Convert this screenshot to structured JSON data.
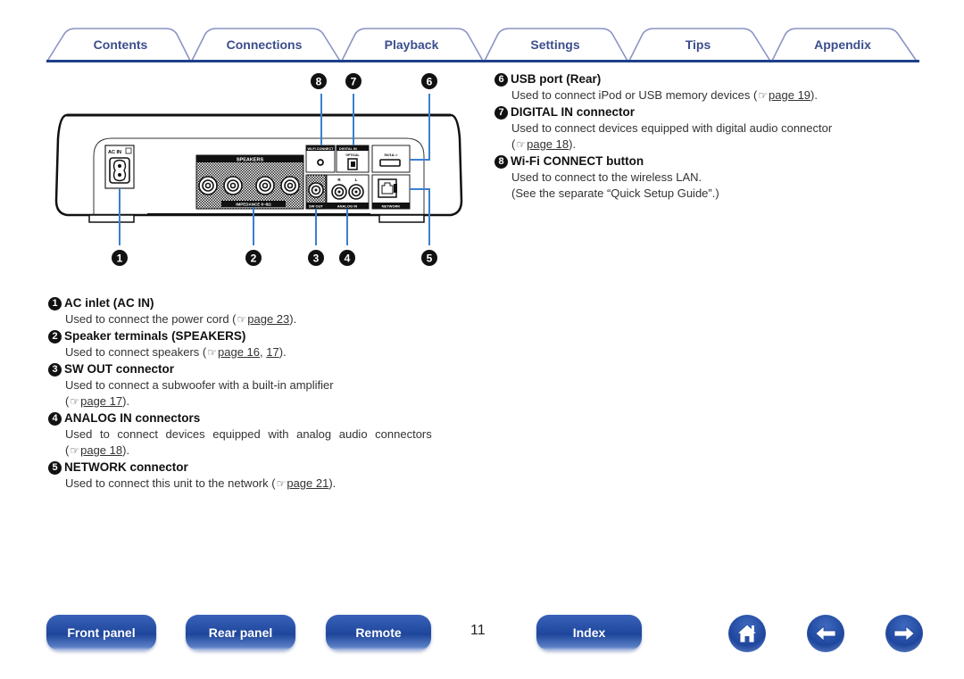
{
  "tabs": [
    {
      "label": "Contents"
    },
    {
      "label": "Connections"
    },
    {
      "label": "Playback"
    },
    {
      "label": "Settings"
    },
    {
      "label": "Tips"
    },
    {
      "label": "Appendix"
    }
  ],
  "device_panel": {
    "labels": {
      "ac_in": "AC IN",
      "speakers": "SPEAKERS",
      "impedance": "IMPEDANCE 6~8Ω",
      "wifi_connect": "Wi-Fi CONNECT",
      "digital_in": "DIGITAL   IN",
      "optical": "OPTICAL",
      "usb": "5V/1A ═",
      "sw_out": "SW OUT",
      "analog_in": "ANALOG IN",
      "analog_r": "R",
      "analog_l": "L",
      "network": "NETWORK"
    },
    "callouts": [
      "1",
      "2",
      "3",
      "4",
      "5",
      "6",
      "7",
      "8"
    ]
  },
  "descriptions_left": [
    {
      "num": "1",
      "title": "AC inlet (AC IN)",
      "text": "Used to connect the power cord (",
      "refs": [
        "page 23"
      ],
      "suffix": ")."
    },
    {
      "num": "2",
      "title": "Speaker terminals (SPEAKERS)",
      "text": "Used to connect speakers (",
      "refs": [
        "page 16",
        "17"
      ],
      "suffix": ")."
    },
    {
      "num": "3",
      "title": "SW OUT connector",
      "text": "Used to connect a subwoofer with a built-in amplifier",
      "refs": [
        "page 17"
      ],
      "suffix": ")."
    },
    {
      "num": "4",
      "title": "ANALOG IN connectors",
      "text": "Used to connect devices equipped with analog audio connectors",
      "refs": [
        "page 18"
      ],
      "suffix": ")."
    },
    {
      "num": "5",
      "title": "NETWORK connector",
      "text": "Used to connect this unit to the network (",
      "refs": [
        "page 21"
      ],
      "suffix": ")."
    }
  ],
  "descriptions_right": [
    {
      "num": "6",
      "title": "USB port (Rear)",
      "text": "Used to connect iPod or USB memory devices (",
      "refs": [
        "page 19"
      ],
      "suffix": ")."
    },
    {
      "num": "7",
      "title": "DIGITAL IN connector",
      "text": "Used to connect devices equipped with digital audio connector",
      "refs": [
        "page 18"
      ],
      "suffix": ")."
    },
    {
      "num": "8",
      "title": "Wi-Fi CONNECT button",
      "text": "Used to connect to the wireless LAN.",
      "text2": "(See the separate “Quick Setup Guide”.)"
    }
  ],
  "footer": {
    "buttons": {
      "front_panel": "Front panel",
      "rear_panel": "Rear panel",
      "remote": "Remote",
      "index": "Index"
    },
    "page_number": "11",
    "icons": {
      "home": "home-icon",
      "back": "arrow-left-icon",
      "forward": "arrow-right-icon"
    }
  },
  "colors": {
    "tab_text": "#3c4e8c",
    "tab_line": "#1e3f8a",
    "callout_line": "#3b7fd0",
    "button_blue": "#1e469c"
  }
}
